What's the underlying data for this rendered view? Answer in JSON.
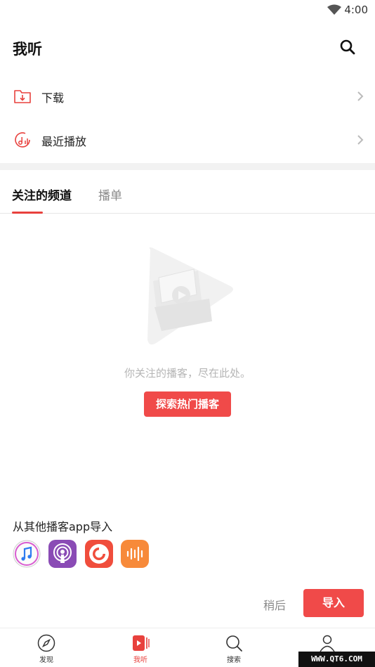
{
  "status_bar": {
    "time": "4:00"
  },
  "header": {
    "title": "我听"
  },
  "menu": [
    {
      "label": "下载",
      "icon": "download-folder-icon"
    },
    {
      "label": "最近播放",
      "icon": "recent-play-icon"
    }
  ],
  "tabs": [
    {
      "label": "关注的频道",
      "active": true
    },
    {
      "label": "播单",
      "active": false
    }
  ],
  "empty_state": {
    "message": "你关注的播客，尽在此处。",
    "button_label": "探索热门播客"
  },
  "import_section": {
    "title": "从其他播客app导入",
    "apps": [
      "itunes-icon",
      "apple-podcasts-icon",
      "pocket-casts-icon",
      "castbox-icon"
    ],
    "later_label": "稍后",
    "import_label": "导入"
  },
  "bottom_nav": [
    {
      "label": "发现",
      "icon": "compass-icon",
      "active": false
    },
    {
      "label": "我听",
      "icon": "my-listen-icon",
      "active": true
    },
    {
      "label": "搜索",
      "icon": "search-icon",
      "active": false
    },
    {
      "label": "",
      "icon": "profile-icon",
      "active": false
    }
  ],
  "watermark": "WWW.QT6.COM",
  "colors": {
    "accent": "#f04a49",
    "divider": "#f2f2f2",
    "muted": "#8a8a8a"
  }
}
